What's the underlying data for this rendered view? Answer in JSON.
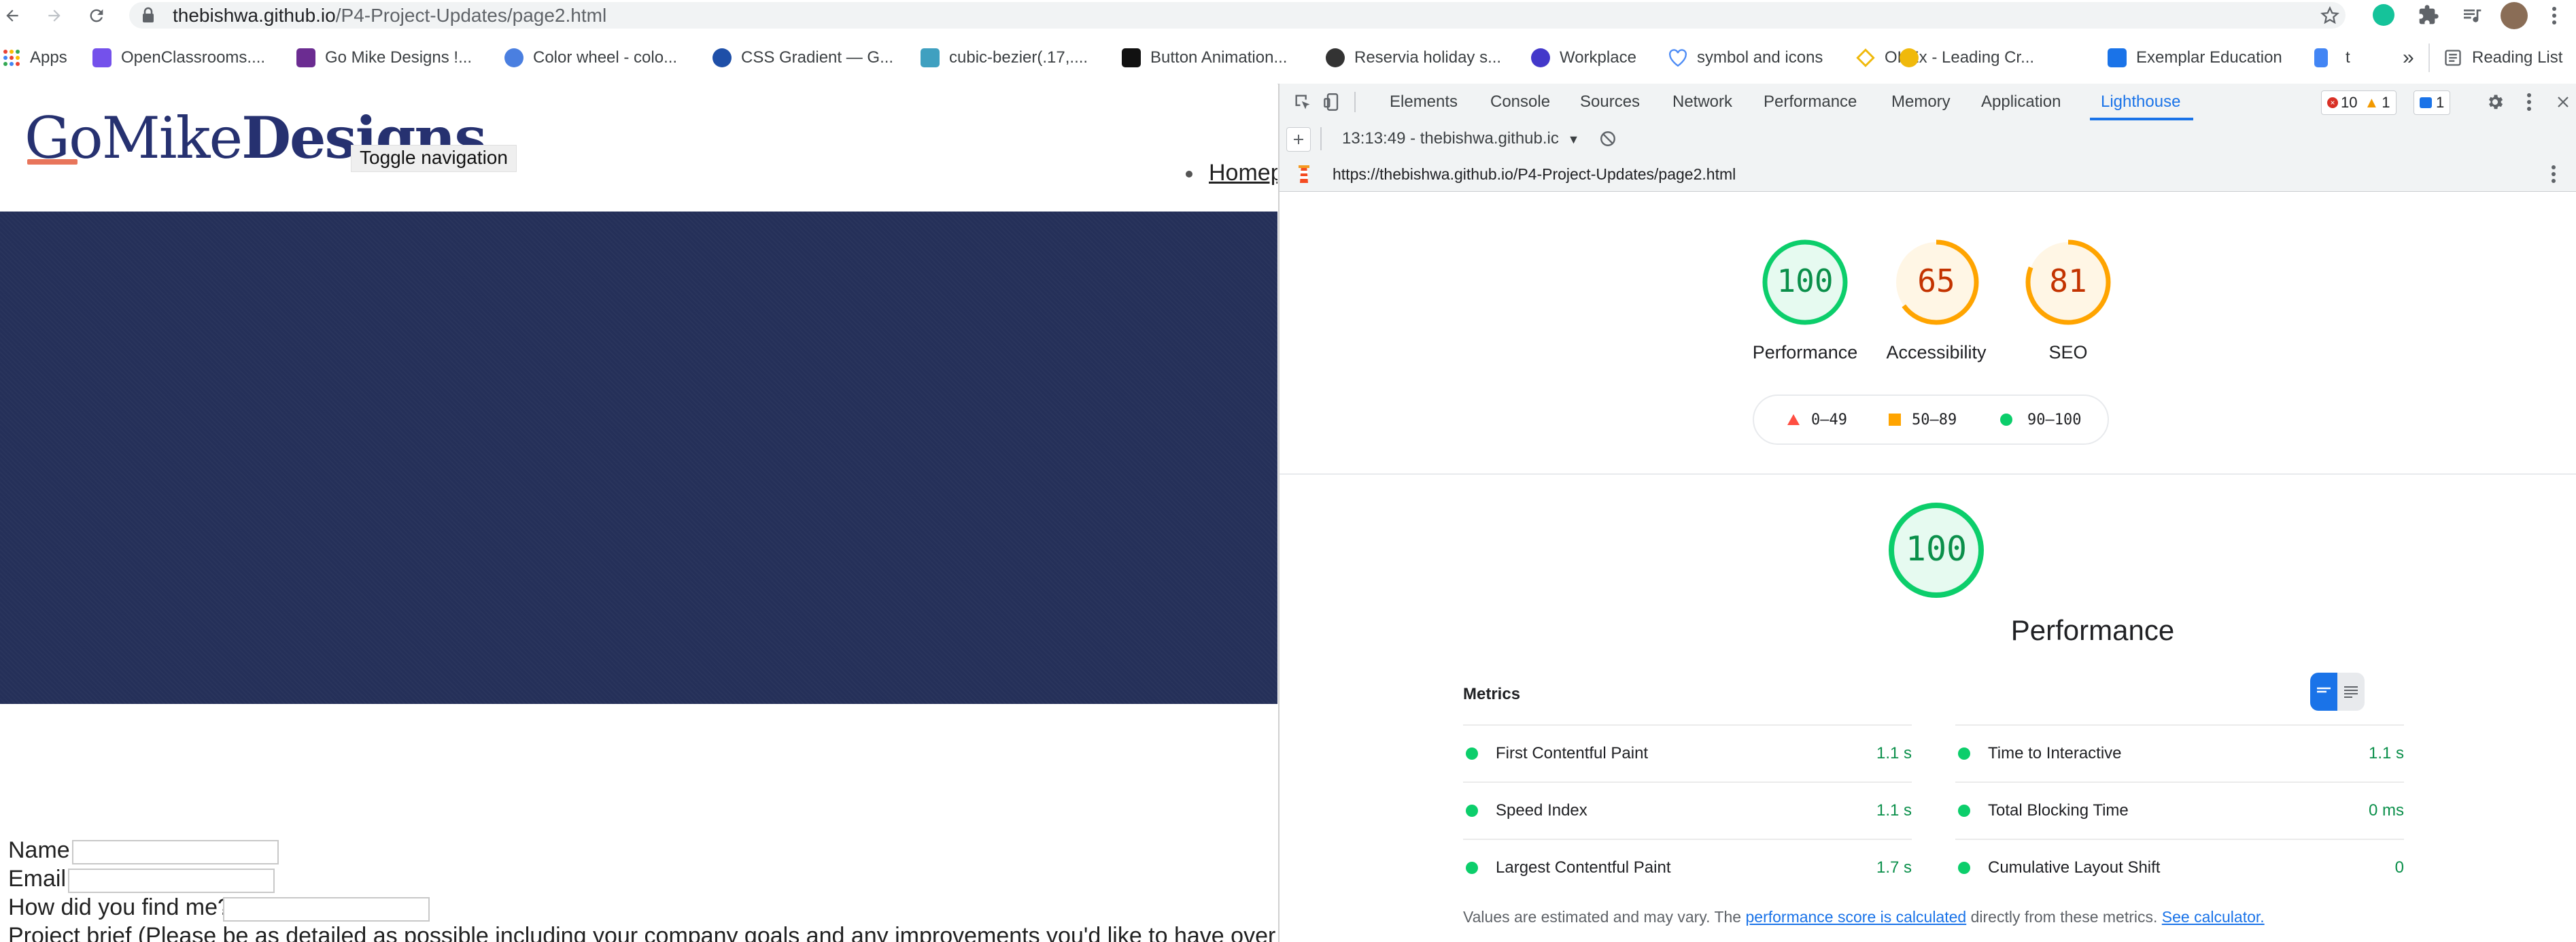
{
  "browser": {
    "url_host": "thebishwa.github.io",
    "url_path": "/P4-Project-Updates/page2.html",
    "bookmarks": [
      {
        "label": "Apps",
        "color": "#ea4335"
      },
      {
        "label": "OpenClassrooms....",
        "color": "#7451eb"
      },
      {
        "label": "Go Mike Designs !...",
        "color": "#6b2c91"
      },
      {
        "label": "Color wheel - colo...",
        "color": "#4a7fe0"
      },
      {
        "label": "CSS Gradient — G...",
        "color": "#1e4fa8"
      },
      {
        "label": "cubic-bezier(.17,....",
        "color": "#3fa0c0"
      },
      {
        "label": "Button Animation...",
        "color": "#111111"
      },
      {
        "label": "Reservia holiday s...",
        "color": "#333333"
      },
      {
        "label": "Workplace",
        "color": "#4338ca"
      },
      {
        "label": "symbol and icons",
        "color": "#4c8bf5"
      },
      {
        "label": "OKEx - Leading Cr...",
        "color": "#f0b90b"
      },
      {
        "label": "Exemplar Education",
        "color": "#1a73e8"
      },
      {
        "label": "t",
        "color": "#4285f4"
      }
    ],
    "overflow_label": "»",
    "reading_list": "Reading List"
  },
  "page": {
    "logo_go": "Go",
    "logo_mike": "Mike",
    "logo_designs": "Designs",
    "toggle_nav": "Toggle navigation",
    "nav_home": "Homepage",
    "form": {
      "name_label": "Name",
      "email_label": "Email",
      "find_label": "How did you find me?",
      "brief_label": "Project brief (Please be as detailed as possible including your company goals and any improvements you'd like to have over your"
    }
  },
  "devtools": {
    "tabs": [
      "Elements",
      "Console",
      "Sources",
      "Network",
      "Performance",
      "Memory",
      "Application",
      "Lighthouse"
    ],
    "active_tab": "Lighthouse",
    "errors": "10",
    "warnings": "1",
    "messages": "1",
    "report_selector": "13:13:49 - thebishwa.github.ic",
    "report_url": "https://thebishwa.github.io/P4-Project-Updates/page2.html",
    "scores": [
      {
        "label": "Performance",
        "score": 100,
        "color": "#0cce6b",
        "text_color": "#0a8f4a"
      },
      {
        "label": "Accessibility",
        "score": 65,
        "color": "#ffa400",
        "text_color": "#c33300"
      },
      {
        "label": "SEO",
        "score": 81,
        "color": "#ffa400",
        "text_color": "#c33300"
      }
    ],
    "legend": [
      {
        "range": "0–49",
        "shape": "triangle",
        "color": "#ff4e42"
      },
      {
        "range": "50–89",
        "shape": "square",
        "color": "#ffa400"
      },
      {
        "range": "90–100",
        "shape": "circle",
        "color": "#0cce6b"
      }
    ],
    "perf_section": {
      "score": 100,
      "title": "Performance"
    },
    "metrics_title": "Metrics",
    "metrics": [
      {
        "name": "First Contentful Paint",
        "value": "1.1 s"
      },
      {
        "name": "Time to Interactive",
        "value": "1.1 s"
      },
      {
        "name": "Speed Index",
        "value": "1.1 s"
      },
      {
        "name": "Total Blocking Time",
        "value": "0 ms"
      },
      {
        "name": "Largest Contentful Paint",
        "value": "1.7 s"
      },
      {
        "name": "Cumulative Layout Shift",
        "value": "0"
      }
    ],
    "note_prefix": "Values are estimated and may vary. The",
    "note_link1": "performance score is calculated",
    "note_middle": "directly from these metrics.",
    "note_link2": "See calculator."
  }
}
